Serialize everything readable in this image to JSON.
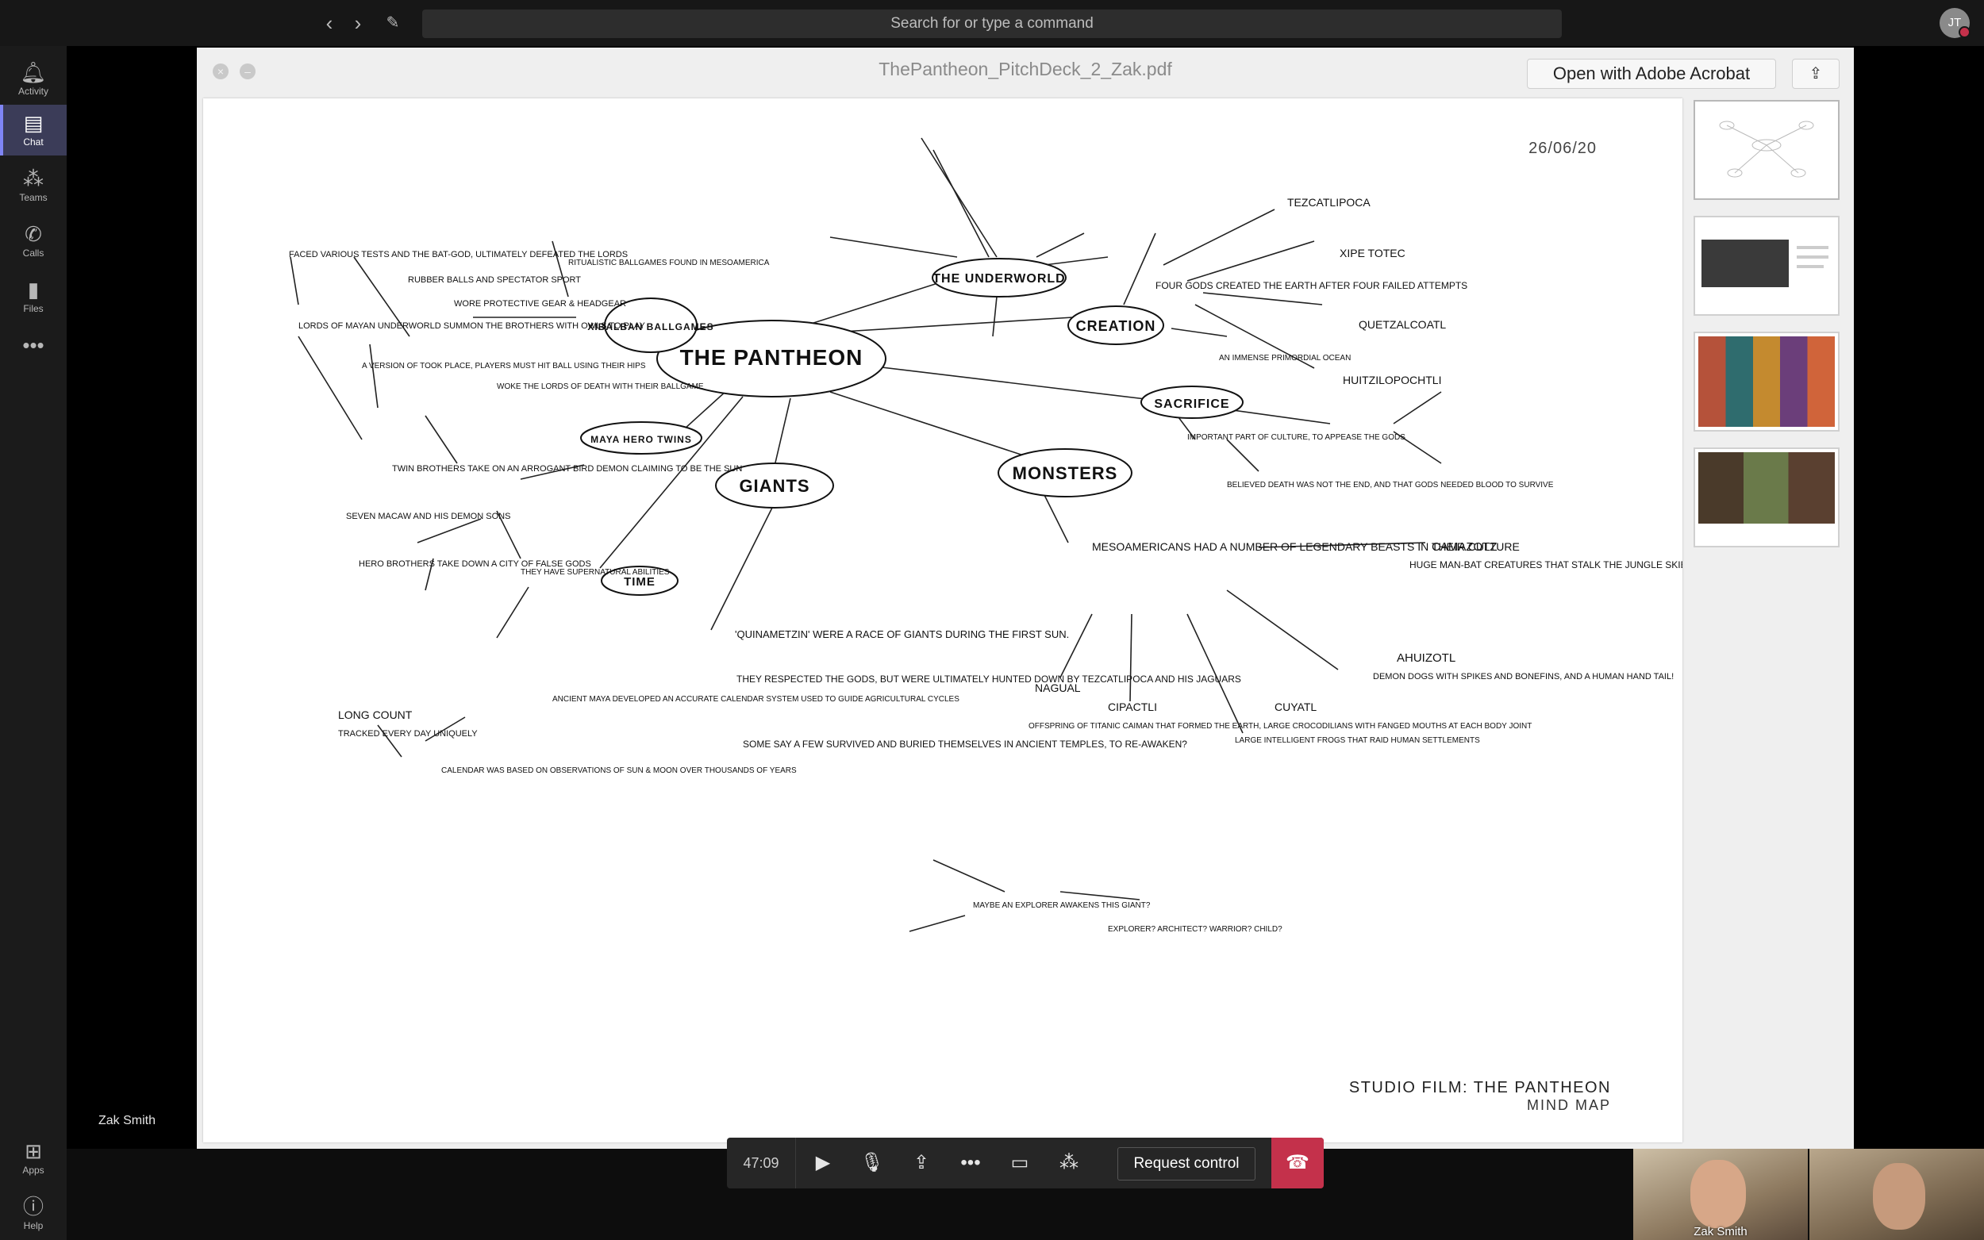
{
  "topbar": {
    "search_placeholder": "Search for or type a command",
    "back_icon": "chevron-left-icon",
    "forward_icon": "chevron-right-icon",
    "compose_icon": "compose-icon",
    "user_initials": "JT",
    "presence_color": "#c4314b"
  },
  "rail": {
    "items": [
      {
        "label": "Activity",
        "icon": "bell-icon"
      },
      {
        "label": "Chat",
        "icon": "chat-icon",
        "active": true
      },
      {
        "label": "Teams",
        "icon": "teams-icon"
      },
      {
        "label": "Calls",
        "icon": "phone-icon"
      },
      {
        "label": "Files",
        "icon": "file-icon"
      },
      {
        "label": "",
        "icon": "more-icon"
      }
    ],
    "bottom": [
      {
        "label": "Apps",
        "icon": "apps-icon"
      },
      {
        "label": "Help",
        "icon": "help-icon"
      }
    ],
    "accent": "#7f85f5"
  },
  "viewer": {
    "title": "ThePantheon_PitchDeck_2_Zak.pdf",
    "open_button": "Open with Adobe Acrobat",
    "share_icon": "share-icon"
  },
  "page": {
    "date": "26/06/20",
    "footer_title": "STUDIO FILM: THE PANTHEON",
    "footer_subtitle": "MIND MAP",
    "center": "THE PANTHEON",
    "nodes": {
      "underworld": "THE UNDERWORLD",
      "creation": "CREATION",
      "sacrifice": "SACRIFICE",
      "monsters": "MONSTERS",
      "giants": "GIANTS",
      "time": "TIME",
      "hero_twins": "MAYA HERO TWINS",
      "ballgames": "XIBALBAN BALLGAMES"
    },
    "notes": {
      "bat_god": "FACED VARIOUS TESTS AND THE BAT-GOD, ULTIMATELY DEFEATED THE LORDS",
      "rubber_balls": "RUBBER BALLS AND SPECTATOR SPORT",
      "protective_gear": "WORE PROTECTIVE GEAR & HEADGEAR",
      "ritualistic": "RITUALISTIC BALLGAMES FOUND IN MESOAMERICA",
      "lords_maya": "LORDS OF MAYAN UNDERWORLD SUMMON THE BROTHERS WITH OWLS TO PLAY",
      "version": "A VERSION OF TOOK PLACE, PLAYERS MUST HIT BALL USING THEIR HIPS",
      "lords_death": "WOKE THE LORDS OF DEATH WITH THEIR BALLGAME",
      "twin_brothers": "TWIN BROTHERS TAKE ON AN ARROGANT BIRD DEMON CLAIMING TO BE THE SUN",
      "seven_macaw": "SEVEN MACAW AND HIS DEMON SONS",
      "hero_brothers": "HERO BROTHERS TAKE DOWN A CITY OF FALSE GODS",
      "supernatural": "THEY HAVE SUPERNATURAL ABILITIES",
      "four_gods": "FOUR GODS CREATED THE EARTH AFTER FOUR FAILED ATTEMPTS",
      "tezcatlipoca": "TEZCATLIPOCA",
      "xipe_totec": "XIPE TOTEC",
      "quetzalcoatl": "QUETZALCOATL",
      "huitzilopochtli": "HUITZILOPOCHTLI",
      "quinametzin": "'QUINAMETZIN' WERE A RACE OF GIANTS DURING THE FIRST SUN.",
      "respected": "THEY RESPECTED THE GODS, BUT WERE ULTIMATELY HUNTED DOWN BY TEZCATLIPOCA AND HIS JAGUARS",
      "survived": "SOME SAY A FEW SURVIVED AND BURIED THEMSELVES IN ANCIENT TEMPLES, TO RE-AWAKEN?",
      "legendary": "MESOAMERICANS HAD A NUMBER OF LEGENDARY BEASTS IN THEIR CULTURE",
      "camazotz": "CAMAZOTZ",
      "camazotz_desc": "HUGE MAN-BAT CREATURES THAT STALK THE JUNGLE SKIES. BAT-GOD.",
      "ahuizotl": "AHUIZOTL",
      "ahuizotl_desc": "DEMON DOGS WITH SPIKES AND BONEFINS, AND A HUMAN HAND TAIL!",
      "nagual": "NAGUAL",
      "cipactli": "CIPACTLI",
      "cipactli_desc": "OFFSPRING OF TITANIC CAIMAN THAT FORMED THE EARTH, LARGE CROCODILIANS WITH FANGED MOUTHS AT EACH BODY JOINT",
      "cuyatl": "CUYATL",
      "cuyatl_desc": "LARGE INTELLIGENT FROGS THAT RAID HUMAN SETTLEMENTS",
      "long_count": "LONG COUNT",
      "long_count_desc": "TRACKED EVERY DAY UNIQUELY",
      "ancient_maya": "ANCIENT MAYA DEVELOPED AN ACCURATE CALENDAR SYSTEM USED TO GUIDE AGRICULTURAL CYCLES",
      "calendar": "CALENDAR WAS BASED ON OBSERVATIONS OF SUN & MOON OVER THOUSANDS OF YEARS",
      "maybe_explorer": "MAYBE AN EXPLORER AWAKENS THIS GIANT?",
      "explorer": "EXPLORER? ARCHITECT? WARRIOR? CHILD?",
      "important": "IMPORTANT PART OF CULTURE, TO APPEASE THE GODS",
      "believed": "BELIEVED DEATH WAS NOT THE END, AND THAT GODS NEEDED BLOOD TO SURVIVE",
      "ocean": "AN IMMENSE PRIMORDIAL OCEAN"
    }
  },
  "controls": {
    "timer": "47:09",
    "request_control": "Request control",
    "hangup_color": "#c4314b"
  },
  "presenter": {
    "name": "Zak Smith"
  },
  "participants": [
    {
      "name": "Zak Smith"
    },
    {
      "name": ""
    }
  ]
}
